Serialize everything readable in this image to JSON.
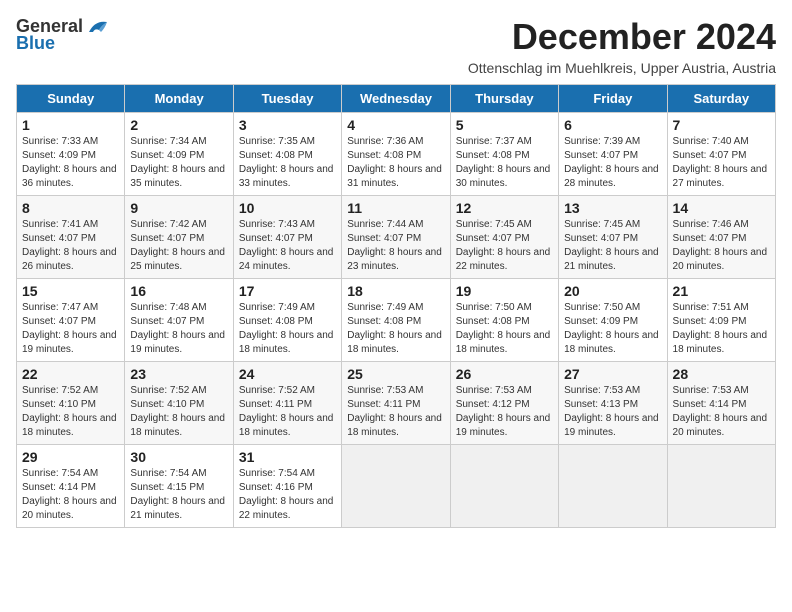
{
  "logo": {
    "general": "General",
    "blue": "Blue"
  },
  "title": "December 2024",
  "subtitle": "Ottenschlag im Muehlkreis, Upper Austria, Austria",
  "days_of_week": [
    "Sunday",
    "Monday",
    "Tuesday",
    "Wednesday",
    "Thursday",
    "Friday",
    "Saturday"
  ],
  "weeks": [
    [
      {
        "day": "1",
        "sunrise": "Sunrise: 7:33 AM",
        "sunset": "Sunset: 4:09 PM",
        "daylight": "Daylight: 8 hours and 36 minutes."
      },
      {
        "day": "2",
        "sunrise": "Sunrise: 7:34 AM",
        "sunset": "Sunset: 4:09 PM",
        "daylight": "Daylight: 8 hours and 35 minutes."
      },
      {
        "day": "3",
        "sunrise": "Sunrise: 7:35 AM",
        "sunset": "Sunset: 4:08 PM",
        "daylight": "Daylight: 8 hours and 33 minutes."
      },
      {
        "day": "4",
        "sunrise": "Sunrise: 7:36 AM",
        "sunset": "Sunset: 4:08 PM",
        "daylight": "Daylight: 8 hours and 31 minutes."
      },
      {
        "day": "5",
        "sunrise": "Sunrise: 7:37 AM",
        "sunset": "Sunset: 4:08 PM",
        "daylight": "Daylight: 8 hours and 30 minutes."
      },
      {
        "day": "6",
        "sunrise": "Sunrise: 7:39 AM",
        "sunset": "Sunset: 4:07 PM",
        "daylight": "Daylight: 8 hours and 28 minutes."
      },
      {
        "day": "7",
        "sunrise": "Sunrise: 7:40 AM",
        "sunset": "Sunset: 4:07 PM",
        "daylight": "Daylight: 8 hours and 27 minutes."
      }
    ],
    [
      {
        "day": "8",
        "sunrise": "Sunrise: 7:41 AM",
        "sunset": "Sunset: 4:07 PM",
        "daylight": "Daylight: 8 hours and 26 minutes."
      },
      {
        "day": "9",
        "sunrise": "Sunrise: 7:42 AM",
        "sunset": "Sunset: 4:07 PM",
        "daylight": "Daylight: 8 hours and 25 minutes."
      },
      {
        "day": "10",
        "sunrise": "Sunrise: 7:43 AM",
        "sunset": "Sunset: 4:07 PM",
        "daylight": "Daylight: 8 hours and 24 minutes."
      },
      {
        "day": "11",
        "sunrise": "Sunrise: 7:44 AM",
        "sunset": "Sunset: 4:07 PM",
        "daylight": "Daylight: 8 hours and 23 minutes."
      },
      {
        "day": "12",
        "sunrise": "Sunrise: 7:45 AM",
        "sunset": "Sunset: 4:07 PM",
        "daylight": "Daylight: 8 hours and 22 minutes."
      },
      {
        "day": "13",
        "sunrise": "Sunrise: 7:45 AM",
        "sunset": "Sunset: 4:07 PM",
        "daylight": "Daylight: 8 hours and 21 minutes."
      },
      {
        "day": "14",
        "sunrise": "Sunrise: 7:46 AM",
        "sunset": "Sunset: 4:07 PM",
        "daylight": "Daylight: 8 hours and 20 minutes."
      }
    ],
    [
      {
        "day": "15",
        "sunrise": "Sunrise: 7:47 AM",
        "sunset": "Sunset: 4:07 PM",
        "daylight": "Daylight: 8 hours and 19 minutes."
      },
      {
        "day": "16",
        "sunrise": "Sunrise: 7:48 AM",
        "sunset": "Sunset: 4:07 PM",
        "daylight": "Daylight: 8 hours and 19 minutes."
      },
      {
        "day": "17",
        "sunrise": "Sunrise: 7:49 AM",
        "sunset": "Sunset: 4:08 PM",
        "daylight": "Daylight: 8 hours and 18 minutes."
      },
      {
        "day": "18",
        "sunrise": "Sunrise: 7:49 AM",
        "sunset": "Sunset: 4:08 PM",
        "daylight": "Daylight: 8 hours and 18 minutes."
      },
      {
        "day": "19",
        "sunrise": "Sunrise: 7:50 AM",
        "sunset": "Sunset: 4:08 PM",
        "daylight": "Daylight: 8 hours and 18 minutes."
      },
      {
        "day": "20",
        "sunrise": "Sunrise: 7:50 AM",
        "sunset": "Sunset: 4:09 PM",
        "daylight": "Daylight: 8 hours and 18 minutes."
      },
      {
        "day": "21",
        "sunrise": "Sunrise: 7:51 AM",
        "sunset": "Sunset: 4:09 PM",
        "daylight": "Daylight: 8 hours and 18 minutes."
      }
    ],
    [
      {
        "day": "22",
        "sunrise": "Sunrise: 7:52 AM",
        "sunset": "Sunset: 4:10 PM",
        "daylight": "Daylight: 8 hours and 18 minutes."
      },
      {
        "day": "23",
        "sunrise": "Sunrise: 7:52 AM",
        "sunset": "Sunset: 4:10 PM",
        "daylight": "Daylight: 8 hours and 18 minutes."
      },
      {
        "day": "24",
        "sunrise": "Sunrise: 7:52 AM",
        "sunset": "Sunset: 4:11 PM",
        "daylight": "Daylight: 8 hours and 18 minutes."
      },
      {
        "day": "25",
        "sunrise": "Sunrise: 7:53 AM",
        "sunset": "Sunset: 4:11 PM",
        "daylight": "Daylight: 8 hours and 18 minutes."
      },
      {
        "day": "26",
        "sunrise": "Sunrise: 7:53 AM",
        "sunset": "Sunset: 4:12 PM",
        "daylight": "Daylight: 8 hours and 19 minutes."
      },
      {
        "day": "27",
        "sunrise": "Sunrise: 7:53 AM",
        "sunset": "Sunset: 4:13 PM",
        "daylight": "Daylight: 8 hours and 19 minutes."
      },
      {
        "day": "28",
        "sunrise": "Sunrise: 7:53 AM",
        "sunset": "Sunset: 4:14 PM",
        "daylight": "Daylight: 8 hours and 20 minutes."
      }
    ],
    [
      {
        "day": "29",
        "sunrise": "Sunrise: 7:54 AM",
        "sunset": "Sunset: 4:14 PM",
        "daylight": "Daylight: 8 hours and 20 minutes."
      },
      {
        "day": "30",
        "sunrise": "Sunrise: 7:54 AM",
        "sunset": "Sunset: 4:15 PM",
        "daylight": "Daylight: 8 hours and 21 minutes."
      },
      {
        "day": "31",
        "sunrise": "Sunrise: 7:54 AM",
        "sunset": "Sunset: 4:16 PM",
        "daylight": "Daylight: 8 hours and 22 minutes."
      },
      null,
      null,
      null,
      null
    ]
  ]
}
